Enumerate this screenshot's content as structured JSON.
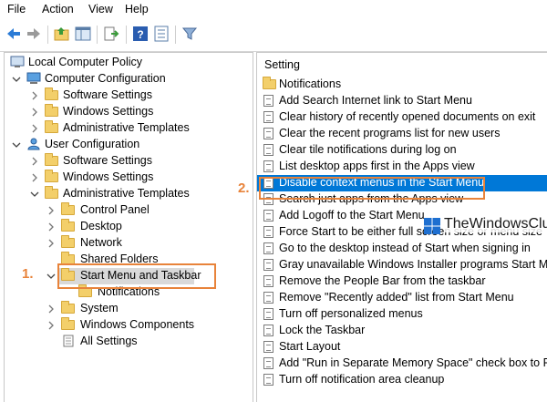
{
  "menubar": {
    "file": "File",
    "action": "Action",
    "view": "View",
    "help": "Help"
  },
  "tree": {
    "root": "Local Computer Policy",
    "computer_config": "Computer Configuration",
    "cc_software": "Software Settings",
    "cc_windows": "Windows Settings",
    "cc_admin": "Administrative Templates",
    "user_config": "User Configuration",
    "uc_software": "Software Settings",
    "uc_windows": "Windows Settings",
    "uc_admin": "Administrative Templates",
    "control_panel": "Control Panel",
    "desktop": "Desktop",
    "network": "Network",
    "shared_folders": "Shared Folders",
    "start_menu": "Start Menu and Taskbar",
    "notifications": "Notifications",
    "system": "System",
    "windows_components": "Windows Components",
    "all_settings": "All Settings"
  },
  "settings": {
    "header": "Setting",
    "folder_item": "Notifications",
    "items": [
      "Add Search Internet link to Start Menu",
      "Clear history of recently opened documents on exit",
      "Clear the recent programs list for new users",
      "Clear tile notifications during log on",
      "List desktop apps first in the Apps view",
      "Disable context menus in the Start Menu",
      "Search just apps from the Apps view",
      "Add Logoff to the Start Menu",
      "Force Start to be either full screen size or menu size",
      "Go to the desktop instead of Start when signing in",
      "Gray unavailable Windows Installer programs Start Menu shortcuts",
      "Remove the People Bar from the taskbar",
      "Remove \"Recently added\" list from Start Menu",
      "Turn off personalized menus",
      "Lock the Taskbar",
      "Start Layout",
      "Add \"Run in Separate Memory Space\" check box to Run dialog box",
      "Turn off notification area cleanup"
    ],
    "selected_index": 5
  },
  "annotations": {
    "step1": "1.",
    "step2": "2.",
    "accent_color": "#e8833a",
    "selection_color": "#0078d7"
  },
  "watermark": {
    "text": "TheWindowsClub"
  }
}
